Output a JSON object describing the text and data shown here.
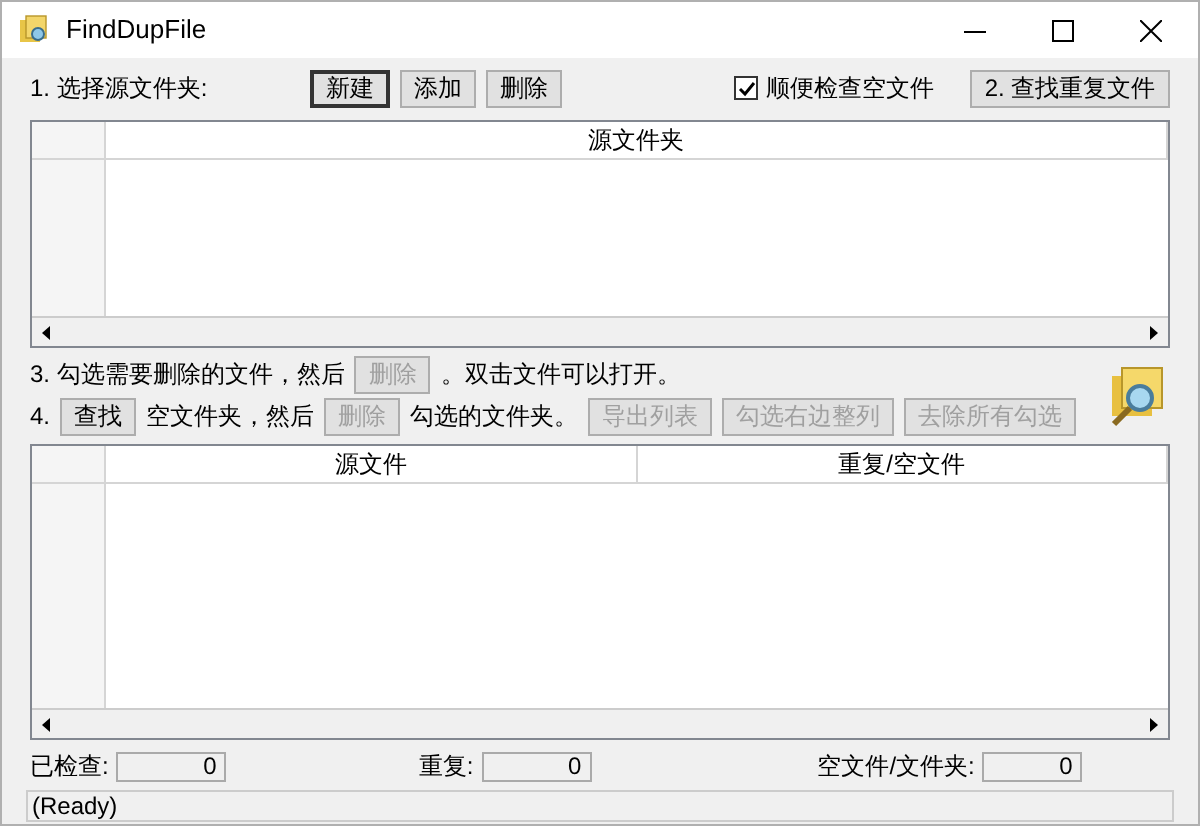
{
  "window": {
    "title": "FindDupFile"
  },
  "step1": {
    "label": "1. 选择源文件夹:",
    "buttons": [
      {
        "label": "新建",
        "default": true,
        "disabled": false
      },
      {
        "label": "添加",
        "default": false,
        "disabled": false
      },
      {
        "label": "删除",
        "default": false,
        "disabled": false
      }
    ],
    "checkbox": {
      "label": "顺便检查空文件",
      "checked": true
    },
    "find_button": {
      "label": "2. 查找重复文件",
      "disabled": false
    }
  },
  "source_table": {
    "columns": [
      "源文件夹"
    ]
  },
  "step3": [
    {
      "kind": "text",
      "label": "3. 勾选需要删除的文件，然后"
    },
    {
      "kind": "button",
      "label": "删除",
      "disabled": true
    },
    {
      "kind": "text",
      "label": "。双击文件可以打开。"
    }
  ],
  "step4": [
    {
      "kind": "text",
      "label": "4."
    },
    {
      "kind": "button",
      "label": "查找",
      "disabled": false
    },
    {
      "kind": "text",
      "label": "空文件夹，然后"
    },
    {
      "kind": "button",
      "label": "删除",
      "disabled": true
    },
    {
      "kind": "text",
      "label": "勾选的文件夹。"
    },
    {
      "kind": "button",
      "label": "导出列表",
      "disabled": true
    },
    {
      "kind": "button",
      "label": "勾选右边整列",
      "disabled": true
    },
    {
      "kind": "button",
      "label": "去除所有勾选",
      "disabled": true
    }
  ],
  "result_table": {
    "columns": [
      "源文件",
      "重复/空文件"
    ]
  },
  "stats": [
    {
      "label": "已检查:",
      "value": "0"
    },
    {
      "label": "重复:",
      "value": "0"
    },
    {
      "label": "空文件/文件夹:",
      "value": "0"
    }
  ],
  "status_bar": "(Ready)"
}
